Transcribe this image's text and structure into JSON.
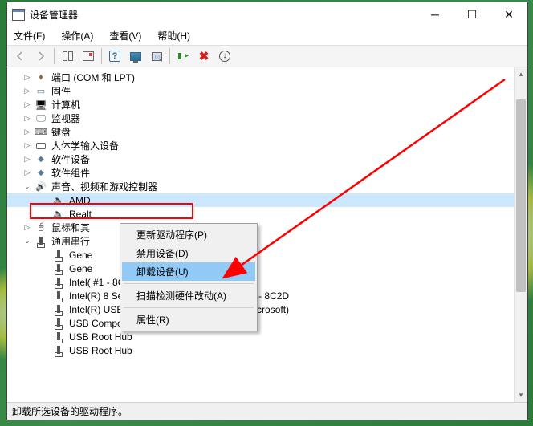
{
  "window": {
    "title": "设备管理器"
  },
  "menus": {
    "file": "文件(F)",
    "action": "操作(A)",
    "view": "查看(V)",
    "help": "帮助(H)"
  },
  "tree": {
    "ports": "端口 (COM 和 LPT)",
    "firmware": "固件",
    "computers": "计算机",
    "monitors": "监视器",
    "keyboards": "键盘",
    "hid": "人体学输入设备",
    "software_devices": "软件设备",
    "software_components": "软件组件",
    "sound": "声音、视频和游戏控制器",
    "sound_children": {
      "amd": "AMD",
      "realtek": "Realt"
    },
    "mouse": "鼠标和其",
    "usb_controllers": "通用串行",
    "usb_children": {
      "g1": "Gene",
      "g2": "Gene",
      "i1": "Intel(                                               #1 - 8C26",
      "i2": "Intel(R) 8 Series/C220 Series USB EHCI #2 - 8C2D",
      "i3": "Intel(R) USB 3.0 可扩展主机控制器 - 1.0 (Microsoft)",
      "c1": "USB Composite Device",
      "r1": "USB Root Hub",
      "r2": "USB Root Hub"
    }
  },
  "context_menu": {
    "update": "更新驱动程序(P)",
    "disable": "禁用设备(D)",
    "uninstall": "卸载设备(U)",
    "scan": "扫描检测硬件改动(A)",
    "properties": "属性(R)"
  },
  "status": "卸载所选设备的驱动程序。"
}
